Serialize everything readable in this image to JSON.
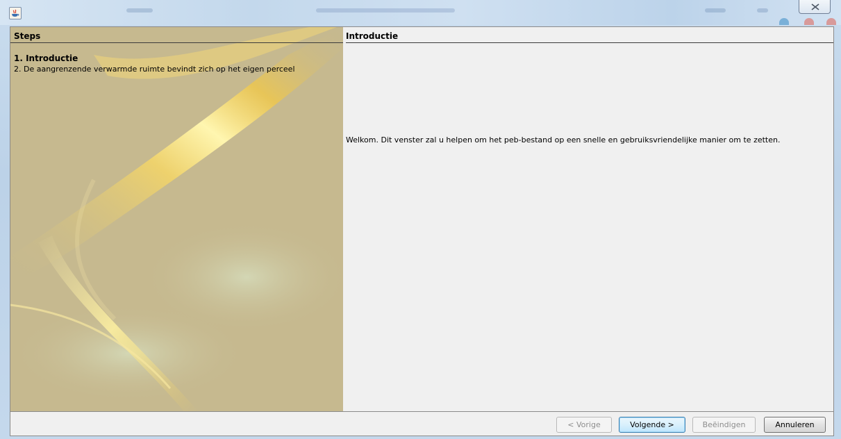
{
  "window": {
    "icon": "java-icon",
    "close_icon": "close-icon"
  },
  "steps_pane": {
    "heading": "Steps",
    "items": [
      {
        "label": "1. Introductie",
        "active": true
      },
      {
        "label": "2. De aangrenzende verwarmde ruimte bevindt zich op het eigen perceel",
        "active": false
      }
    ]
  },
  "content_pane": {
    "heading": "Introductie",
    "message": "Welkom. Dit venster zal u helpen om het peb-bestand op een snelle en gebruiksvriendelijke manier om te zetten."
  },
  "buttons": {
    "previous": "< Vorige",
    "next": "Volgende >",
    "finish": "Beëindigen",
    "cancel": "Annuleren"
  },
  "colors": {
    "steps_background": "#c6b98f",
    "content_background": "#f0f0f0",
    "default_button_border": "#3c7fb1"
  }
}
